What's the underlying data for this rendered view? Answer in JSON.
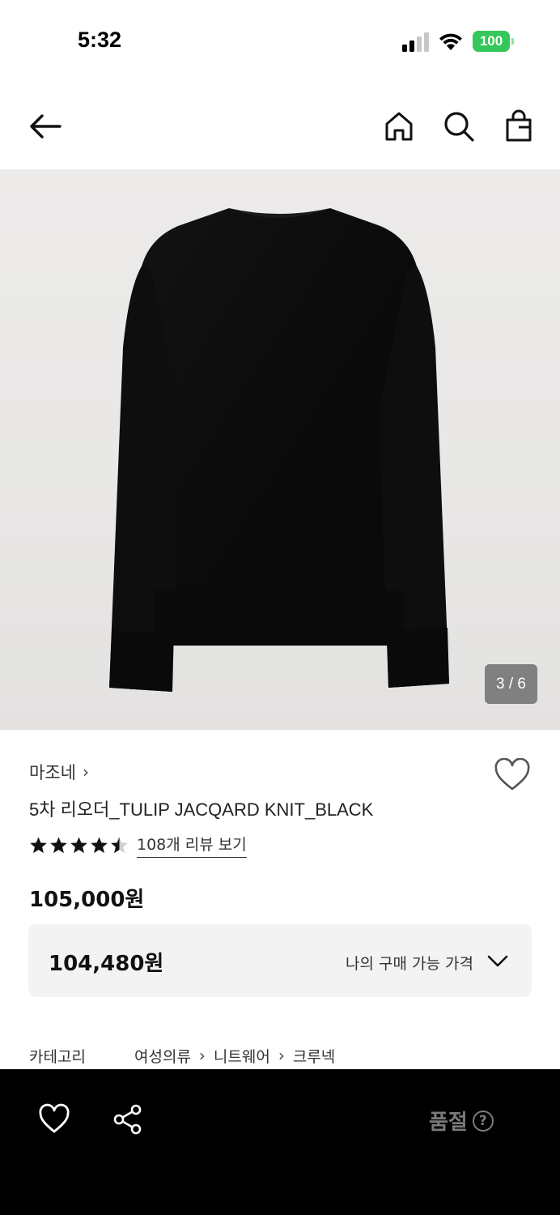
{
  "status_bar": {
    "time": "5:32",
    "battery": "100"
  },
  "product": {
    "brand": "마조네",
    "name": "5차 리오더_TULIP JACQARD KNIT_BLACK",
    "rating": 4.5,
    "review_link": "108개 리뷰 보기",
    "price": "105,000원",
    "image_counter": "3 / 6",
    "my_price": "104,480원",
    "my_price_label": "나의 구매 가능 가격"
  },
  "category": {
    "label": "카테고리",
    "path": [
      "여성의류",
      "니트웨어",
      "크루넥"
    ]
  },
  "bottom_bar": {
    "soldout_label": "품절",
    "help_glyph": "?"
  },
  "icons": [
    "back-arrow-icon",
    "home-icon",
    "search-icon",
    "shopping-bag-icon",
    "heart-icon",
    "share-icon",
    "star-icon",
    "chevron-down-icon",
    "help-icon"
  ],
  "colors": {
    "accent_battery": "#35c759",
    "bottom_bar": "#000000",
    "price_box": "#f3f3f3",
    "soldout_text": "#7a7a7a"
  }
}
